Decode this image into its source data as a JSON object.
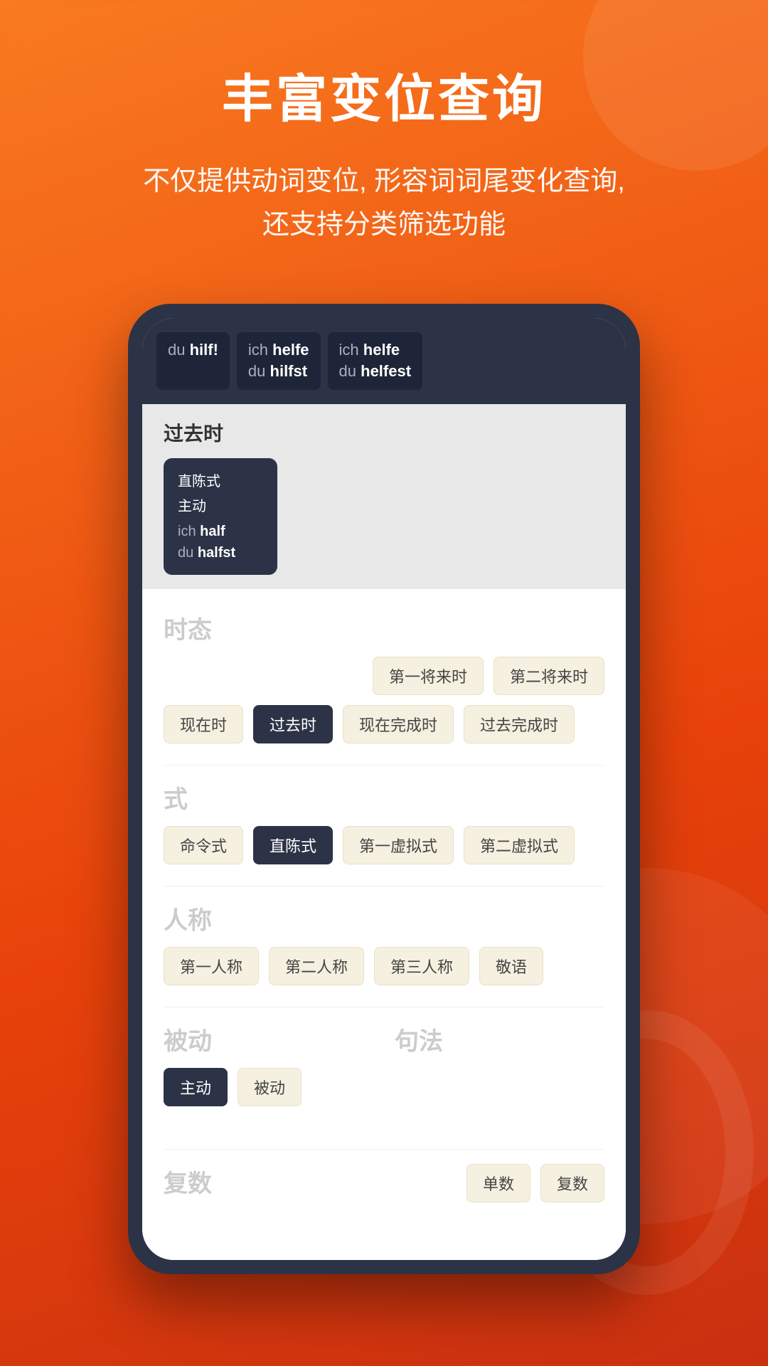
{
  "page": {
    "background": "gradient-orange-red",
    "title": "丰富变位查询",
    "subtitle": "不仅提供动词变位, 形容词词尾变化查询,\n还支持分类筛选功能"
  },
  "phone": {
    "tooltips": [
      {
        "pronoun": "du",
        "verb": "hilf!",
        "multiline": false
      },
      {
        "pronoun_line1": "ich",
        "verb_line1": "helfe",
        "pronoun_line2": "du",
        "verb_line2": "hilfst",
        "multiline": true
      },
      {
        "pronoun_line1": "ich",
        "verb_line1": "helfe",
        "pronoun_line2": "du",
        "verb_line2": "helfest",
        "multiline": true
      }
    ],
    "conjugation_card": {
      "tense": "过去时",
      "mood": "直陈式",
      "voice": "主动",
      "line1_pronoun": "ich",
      "line1_verb": "half",
      "line2_pronoun": "du",
      "line2_verb": "halfst"
    },
    "filters": {
      "tense_label": "时态",
      "tense_row1": [
        "第一将来时",
        "第二将来时"
      ],
      "tense_row2": [
        "现在时",
        "过去时",
        "现在完成时",
        "过去完成时"
      ],
      "mood_label": "式",
      "mood_tags": [
        "命令式",
        "直陈式",
        "第一虚拟式",
        "第二虚拟式"
      ],
      "person_label": "人称",
      "person_tags": [
        "第一人称",
        "第二人称",
        "第三人称",
        "敬语"
      ],
      "voice_label": "被动",
      "voice_tags": [
        "主动",
        "被动"
      ],
      "syntax_label": "句法",
      "plural_label": "复数",
      "plural_tags": [
        "单数",
        "复数"
      ]
    }
  }
}
